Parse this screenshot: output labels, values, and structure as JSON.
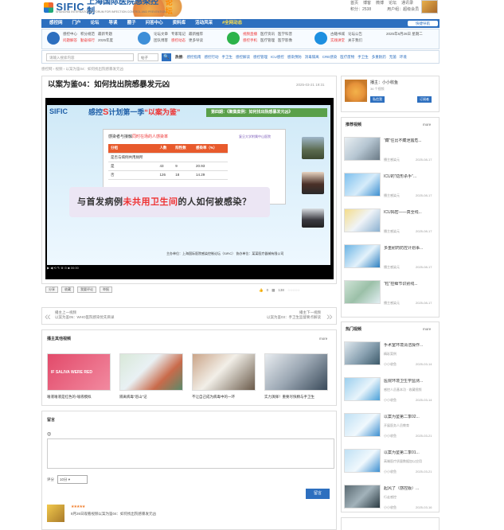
{
  "header": {
    "logo_en": "SIFIC",
    "logo_cn": "上海国际医院感染控制",
    "logo_tag": "论坛",
    "logo_sub": "SHANGHAI INTERNATIONAL FORUM FOR INFECTION CONTROL AND PREVENTION",
    "links": [
      "首页",
      "博客",
      "微博",
      "论坛",
      "通讯录"
    ],
    "points": "积分：2538",
    "user": "用户组：超级会员"
  },
  "nav": {
    "items": [
      "感控网",
      "门户",
      "论坛",
      "导读",
      "圈子",
      "问答中心",
      "资料库",
      "活动风采",
      "#全网动态"
    ],
    "right": "快捷导航"
  },
  "subnav": {
    "g1a": [
      "感控中心",
      "积分规范",
      "最新专题"
    ],
    "g1b": [
      "问题解答",
      "勤奋排行",
      "2025年度"
    ],
    "g2a": [
      "论坛文章",
      "专家笔记",
      "最新推荐"
    ],
    "g2b": [
      "团队博客",
      "感控动态",
      "更多导读"
    ],
    "g3a": [
      "视频直播",
      "医疗资讯",
      "医学科普"
    ],
    "g3b": [
      "感控手机",
      "医疗管理",
      "医学影像"
    ],
    "g4a": [
      "古籍书城",
      "论坛公告"
    ],
    "g4b": [
      "实践讲堂",
      "关于我们"
    ],
    "date": "2025年8月26日 星期二"
  },
  "search": {
    "placeholder": "请输入搜索内容",
    "select": "帖子",
    "btn": "🔍",
    "hot_label": "热搜:",
    "hot": [
      "感控指南",
      "感控行动",
      "手卫生",
      "感控解读",
      "感控管理",
      "ICU感控",
      "感染预防",
      "消毒隔离",
      "CRE感染",
      "医疗废物",
      "手卫生",
      "多重耐药",
      "无菌",
      "环境"
    ]
  },
  "crumb": "感控网 › 视频 › 以案为鉴04：如何找出院感暴发元凶",
  "video": {
    "title": "以案为鉴04：如何找出院感暴发元凶",
    "date": "2025-03-21 19:31",
    "slide_logo": "SIFIC",
    "slide_title_a": "感控",
    "slide_title_s": "S",
    "slide_title_b": "计划第一季",
    "slide_title_q": "“以案为鉴”",
    "slide_banner": "第四期：《聚集案例：如何找出院感暴发元凶》",
    "paper_title_a": "感染者与接触",
    "paper_title_red": "同时在场的人感染率",
    "table": [
      [
        "分组",
        "人数",
        "阳性数",
        "感染率（%）"
      ],
      [
        "是否与病例共用厕所",
        "",
        "",
        ""
      ],
      [
        "是",
        "43",
        "9",
        "20.93"
      ],
      [
        "否",
        "126",
        "18",
        "14.29"
      ]
    ],
    "paper_logo": "复旦大学附属中山医院",
    "question_a": "与首发病例",
    "question_red": "未共用卫生间",
    "question_b": "的人如何被感染？",
    "slide_foot": "主办单位：上海国际医院感染控制论坛（SIFIC）  协办单位：某某医疗器械有限公司",
    "ctrl": "▶ ◀ ⟲ ✎ ⊕ ⊙ ■  00:00"
  },
  "actions": [
    "分享",
    "收藏",
    "我要评论",
    "举报"
  ],
  "stats": {
    "likes": "0",
    "views": "138",
    "stars": "☆☆☆☆☆"
  },
  "prevnext": {
    "prev_label": "播主上一视频",
    "prev_title": "以案为鉴05：WHO医院感染优先目录",
    "next_label": "播主下一视频",
    "next_title": "以案为鉴03：手卫生监督要点解读"
  },
  "others": {
    "title": "播主其他视频",
    "more": "more",
    "items": [
      {
        "caption": "唾液唾液是红色的-唾液模拟",
        "overlay": "IF SALIVA WERE RED"
      },
      {
        "caption": "隔离病毒“巡山”记",
        "overlay": ""
      },
      {
        "caption": "不让自己成为病毒中的一环",
        "overlay": ""
      },
      {
        "caption": "实力演绎！重要尽快精与手卫生",
        "overlay": ""
      }
    ]
  },
  "comment": {
    "title": "留言",
    "rate_label": "评分",
    "rate_value": "10分",
    "submit": "留言",
    "row_stars": "★★★★★",
    "row_text": "8月26日观看视频以案为鉴04：如何找出院感暴发元凶"
  },
  "uploader": {
    "name": "播主：小小收鱼",
    "count": "36 个视频",
    "btn_private": "私信我",
    "btn_follow": "订阅者"
  },
  "recommend": {
    "title": "推荐视频",
    "more": "more",
    "items": [
      {
        "title": "“藏”住比不藏泄露危...",
        "author": "播主感染元",
        "date": "2025-08-17"
      },
      {
        "title": "ICU的“隐形杀手”...",
        "author": "播主感染元",
        "date": "2025-08-17"
      },
      {
        "title": "ICU揭密——真全线...",
        "author": "播主感染元",
        "date": "2025-08-17"
      },
      {
        "title": "多重耐药防控计划事...",
        "author": "播主感染元",
        "date": "2025-08-17"
      },
      {
        "title": "“粒”控细节识别线...",
        "author": "播主感染元",
        "date": "2025-08-17"
      }
    ]
  },
  "hotvideo": {
    "title": "热门视频",
    "more": "more",
    "items": [
      {
        "title": "手术室环境清洁操作...",
        "sub": "精彩案例",
        "author": "小小收鱼",
        "date": "2025-03-14"
      },
      {
        "title": "医院环境卫生学监测...",
        "sub": "感控人员基本功 · 收藏视频",
        "author": "小小收鱼",
        "date": "2025-03-14"
      },
      {
        "title": "以案为鉴第二季02...",
        "sub": "开展医务人员教育",
        "author": "小小收鱼",
        "date": "2025-03-21"
      },
      {
        "title": "以案为鉴第二季01...",
        "sub": "高端医疗质量数据加以应用",
        "author": "小小收鱼",
        "date": "2025-03-21"
      },
      {
        "title": "起风了（感控版）...",
        "sub": "行走感控",
        "author": "小小收鱼",
        "date": "2025-03-16"
      }
    ]
  },
  "colors": {
    "brand": "#2d6fbf",
    "accent": "#e33",
    "nav_highlight": "#ffe04a"
  }
}
